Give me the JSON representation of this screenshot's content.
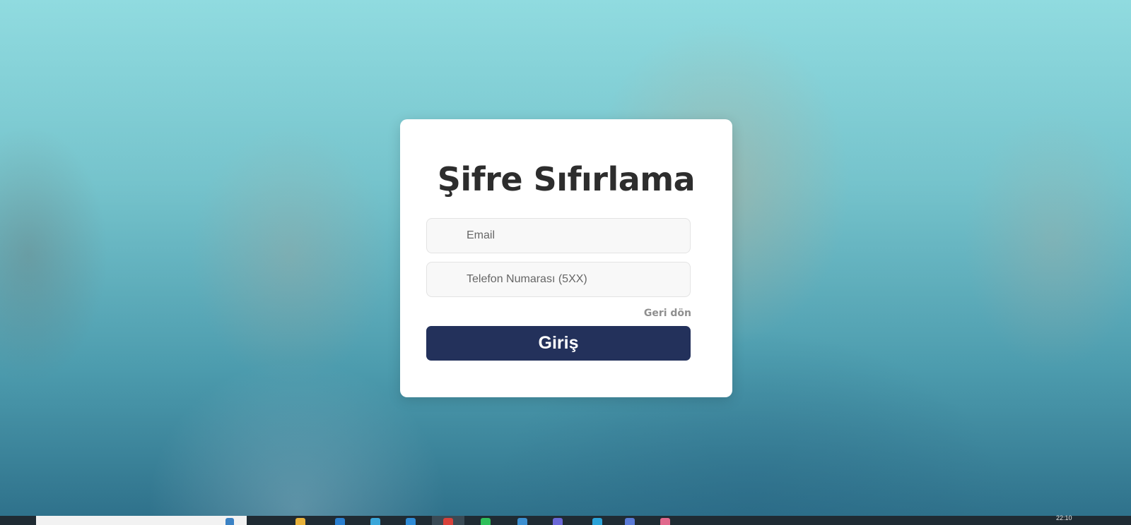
{
  "form": {
    "title": "Şifre Sıfırlama",
    "email_placeholder": "Email",
    "phone_placeholder": "Telefon Numarası (5XX)",
    "back_link": "Geri dön",
    "submit_label": "Giriş"
  },
  "colors": {
    "button_bg": "#23315b",
    "card_bg": "#ffffff",
    "title_color": "#2d2d2d",
    "link_color": "#8f8f8f"
  },
  "taskbar": {
    "clock": "22:10",
    "icons": [
      "search-box",
      "taskview-icon",
      "file-explorer-icon",
      "store-icon",
      "edge-icon",
      "app-icon-1",
      "app-icon-2",
      "chrome-icon",
      "spotify-icon",
      "app-icon-3",
      "app-icon-4",
      "app-icon-5",
      "app-icon-6"
    ]
  }
}
